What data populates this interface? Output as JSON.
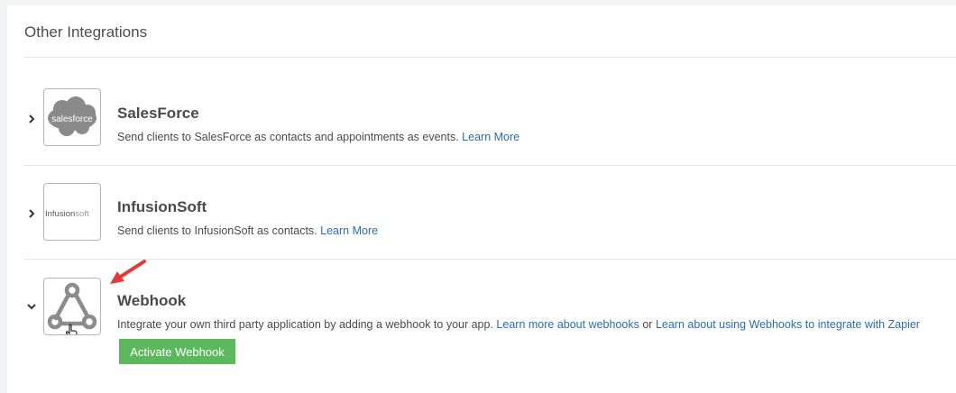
{
  "section": {
    "title": "Other Integrations"
  },
  "integrations": [
    {
      "name": "SalesForce",
      "logo_text": "salesforce",
      "description": "Send clients to SalesForce as contacts and appointments as events.",
      "link": "Learn More",
      "expanded": false
    },
    {
      "name": "InfusionSoft",
      "logo_text_a": "Infusion",
      "logo_text_b": "soft",
      "description": "Send clients to InfusionSoft as contacts.",
      "link": "Learn More",
      "expanded": false
    },
    {
      "name": "Webhook",
      "description": "Integrate your own third party application by adding a webhook to your app.",
      "link1": "Learn more about webhooks",
      "or": "or",
      "link2": "Learn about using Webhooks to integrate with Zapier",
      "button": "Activate Webhook",
      "expanded": true
    }
  ],
  "colors": {
    "button": "#5cb85c",
    "link": "#2b6cb0",
    "arrow": "#e53935"
  }
}
